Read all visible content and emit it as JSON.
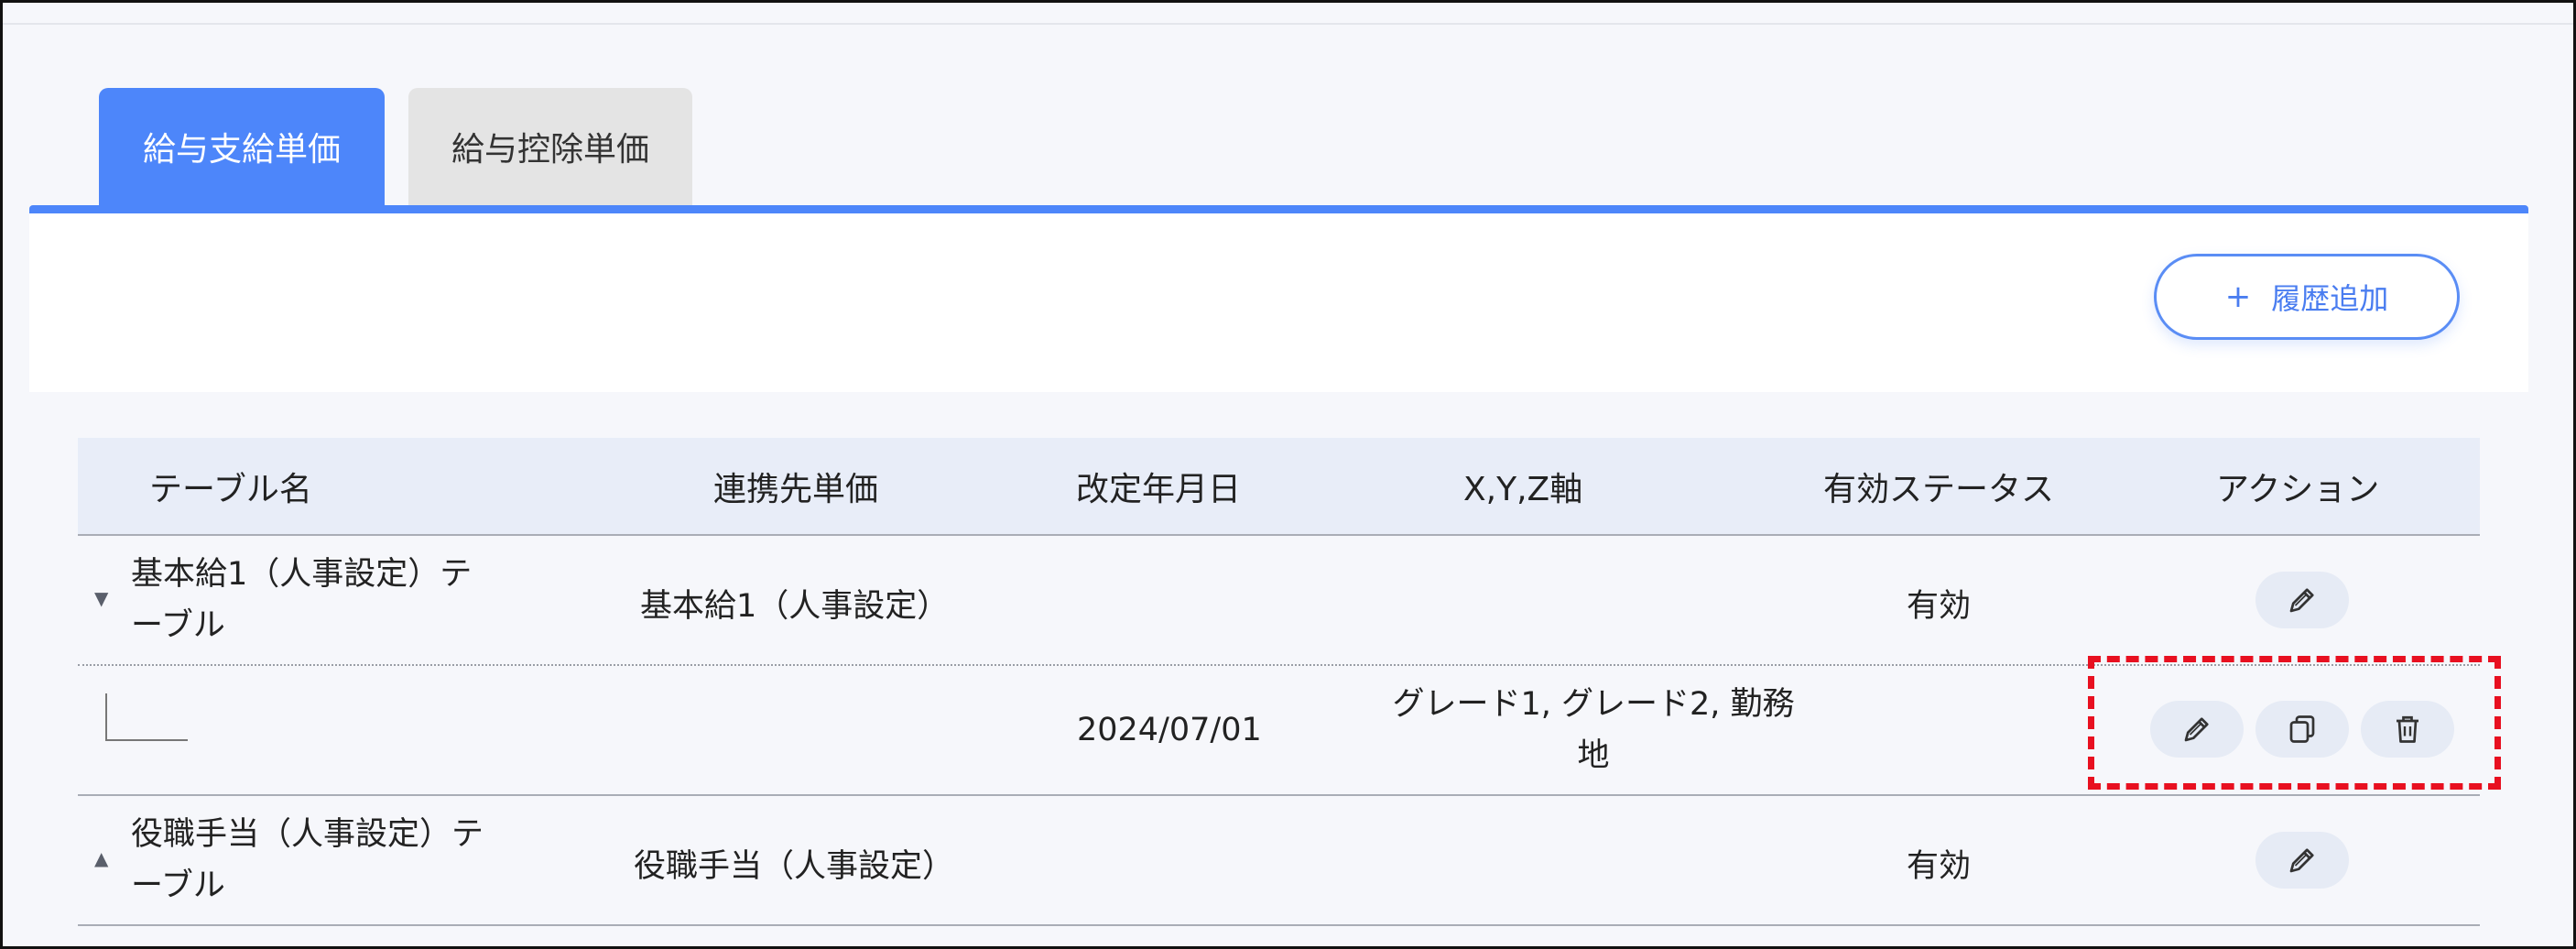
{
  "tabs": [
    {
      "label": "給与支給単価",
      "active": true
    },
    {
      "label": "給与控除単価",
      "active": false
    }
  ],
  "toolbar": {
    "add_history_label": "履歴追加",
    "add_icon": "plus-icon"
  },
  "table": {
    "columns": [
      "テーブル名",
      "連携先単価",
      "改定年月日",
      "X,Y,Z軸",
      "有効ステータス",
      "アクション"
    ],
    "rows": [
      {
        "type": "parent",
        "expanded": true,
        "name_line1": "基本給1（人事設定）テ",
        "name_line2": "ーブル",
        "linked_rate": "基本給1（人事設定）",
        "revision_date": "",
        "axes": "",
        "status": "有効",
        "actions": [
          "edit"
        ]
      },
      {
        "type": "child",
        "name": "",
        "linked_rate": "",
        "revision_date": "2024/07/01",
        "axes_line1": "グレード1, グレード2, 勤務",
        "axes_line2": "地",
        "status": "",
        "actions": [
          "edit",
          "copy",
          "delete"
        ]
      },
      {
        "type": "parent",
        "expanded": false,
        "name_line1": "役職手当（人事設定）テ",
        "name_line2": "ーブル",
        "linked_rate": "役職手当（人事設定）",
        "revision_date": "",
        "axes": "",
        "status": "有効",
        "actions": [
          "edit"
        ]
      }
    ]
  },
  "colors": {
    "accent": "#4d86fa",
    "highlight": "#e81020",
    "inactive_tab": "#e4e4e4",
    "header_bg": "#e8edf8"
  }
}
